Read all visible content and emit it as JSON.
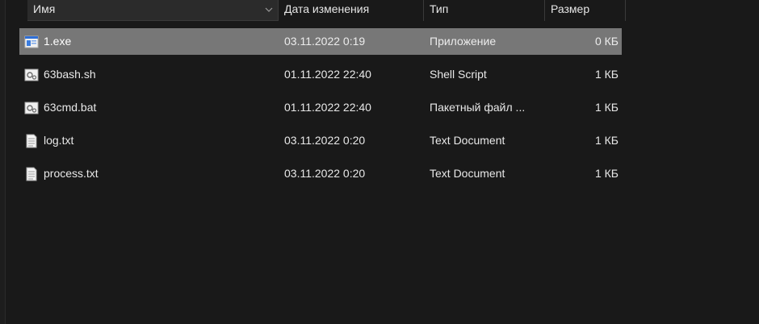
{
  "columns": {
    "name": "Имя",
    "date": "Дата изменения",
    "type": "Тип",
    "size": "Размер"
  },
  "files": [
    {
      "name": "1.exe",
      "date": "03.11.2022 0:19",
      "type": "Приложение",
      "size": "0 КБ",
      "icon": "application-icon",
      "selected": true
    },
    {
      "name": "63bash.sh",
      "date": "01.11.2022 22:40",
      "type": "Shell Script",
      "size": "1 КБ",
      "icon": "script-file-icon",
      "selected": false
    },
    {
      "name": "63cmd.bat",
      "date": "01.11.2022 22:40",
      "type": "Пакетный файл ...",
      "size": "1 КБ",
      "icon": "batch-file-icon",
      "selected": false
    },
    {
      "name": "log.txt",
      "date": "03.11.2022 0:20",
      "type": "Text Document",
      "size": "1 КБ",
      "icon": "text-document-icon",
      "selected": false
    },
    {
      "name": "process.txt",
      "date": "03.11.2022 0:20",
      "type": "Text Document",
      "size": "1 КБ",
      "icon": "text-document-icon",
      "selected": false
    }
  ]
}
